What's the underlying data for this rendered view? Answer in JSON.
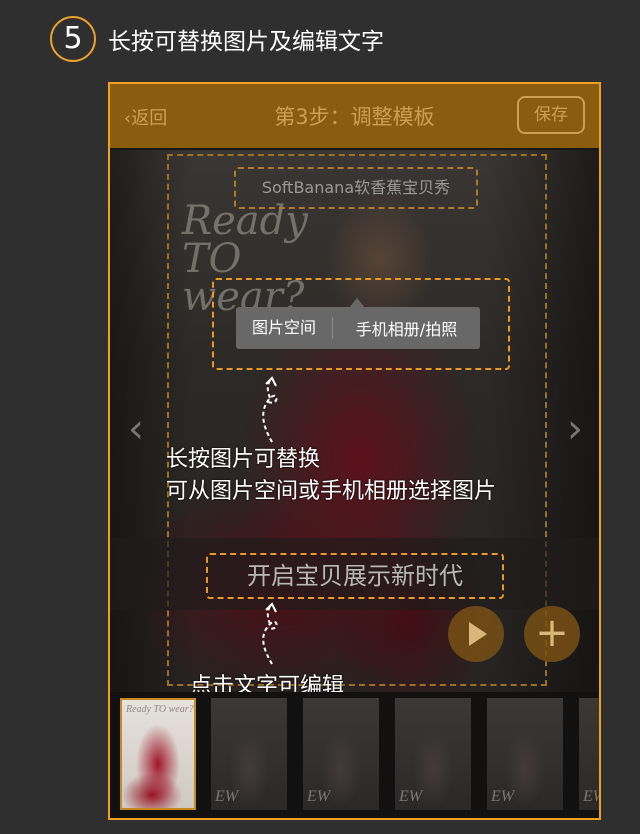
{
  "header": {
    "step_number": "5",
    "title": "长按可替换图片及编辑文字"
  },
  "app": {
    "back_label": "返回",
    "back_chevron": "‹",
    "title": "第3步：调整模板",
    "save_label": "保存"
  },
  "template": {
    "brand_text": "SoftBanana软香蕉宝贝秀",
    "magazine_headline": "Ready TO wear?",
    "caption_text": "开启宝贝展示新时代"
  },
  "image_menu": {
    "options": [
      "图片空间",
      "手机相册/拍照"
    ]
  },
  "callouts": {
    "image_line1": "长按图片可替换",
    "image_line2": "可从图片空间或手机相册选择图片",
    "text_hint": "点击文字可编辑"
  },
  "nav": {
    "prev_glyph": "‹",
    "next_glyph": "›"
  },
  "buttons": {
    "play_icon": "play-icon",
    "add_glyph": "+"
  },
  "thumbnails": {
    "first_label": "Ready TO wear?",
    "other_label": "EW"
  },
  "colors": {
    "accent": "#f0a020",
    "topbar": "#8a5c10",
    "background": "#2f2f2f"
  }
}
